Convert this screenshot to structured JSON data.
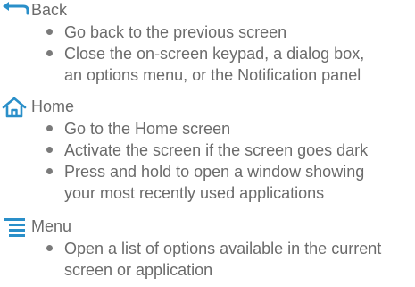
{
  "accent_color": "#2a8fc9",
  "text_color": "#6b6b6b",
  "sections": [
    {
      "icon": "back-arrow-icon",
      "title": "Back",
      "items": [
        "Go back to the previous screen",
        "Close the on-screen keypad, a dialog box,",
        "an options menu, or the Notification panel"
      ]
    },
    {
      "icon": "home-icon",
      "title": "Home",
      "items": [
        "Go to the Home screen",
        "Activate the screen if the screen goes dark",
        "Press and hold to open a window showing",
        "your most recently used applications"
      ]
    },
    {
      "icon": "menu-icon",
      "title": "Menu",
      "items": [
        "Open a list of options available in the current",
        "screen or application"
      ]
    }
  ]
}
